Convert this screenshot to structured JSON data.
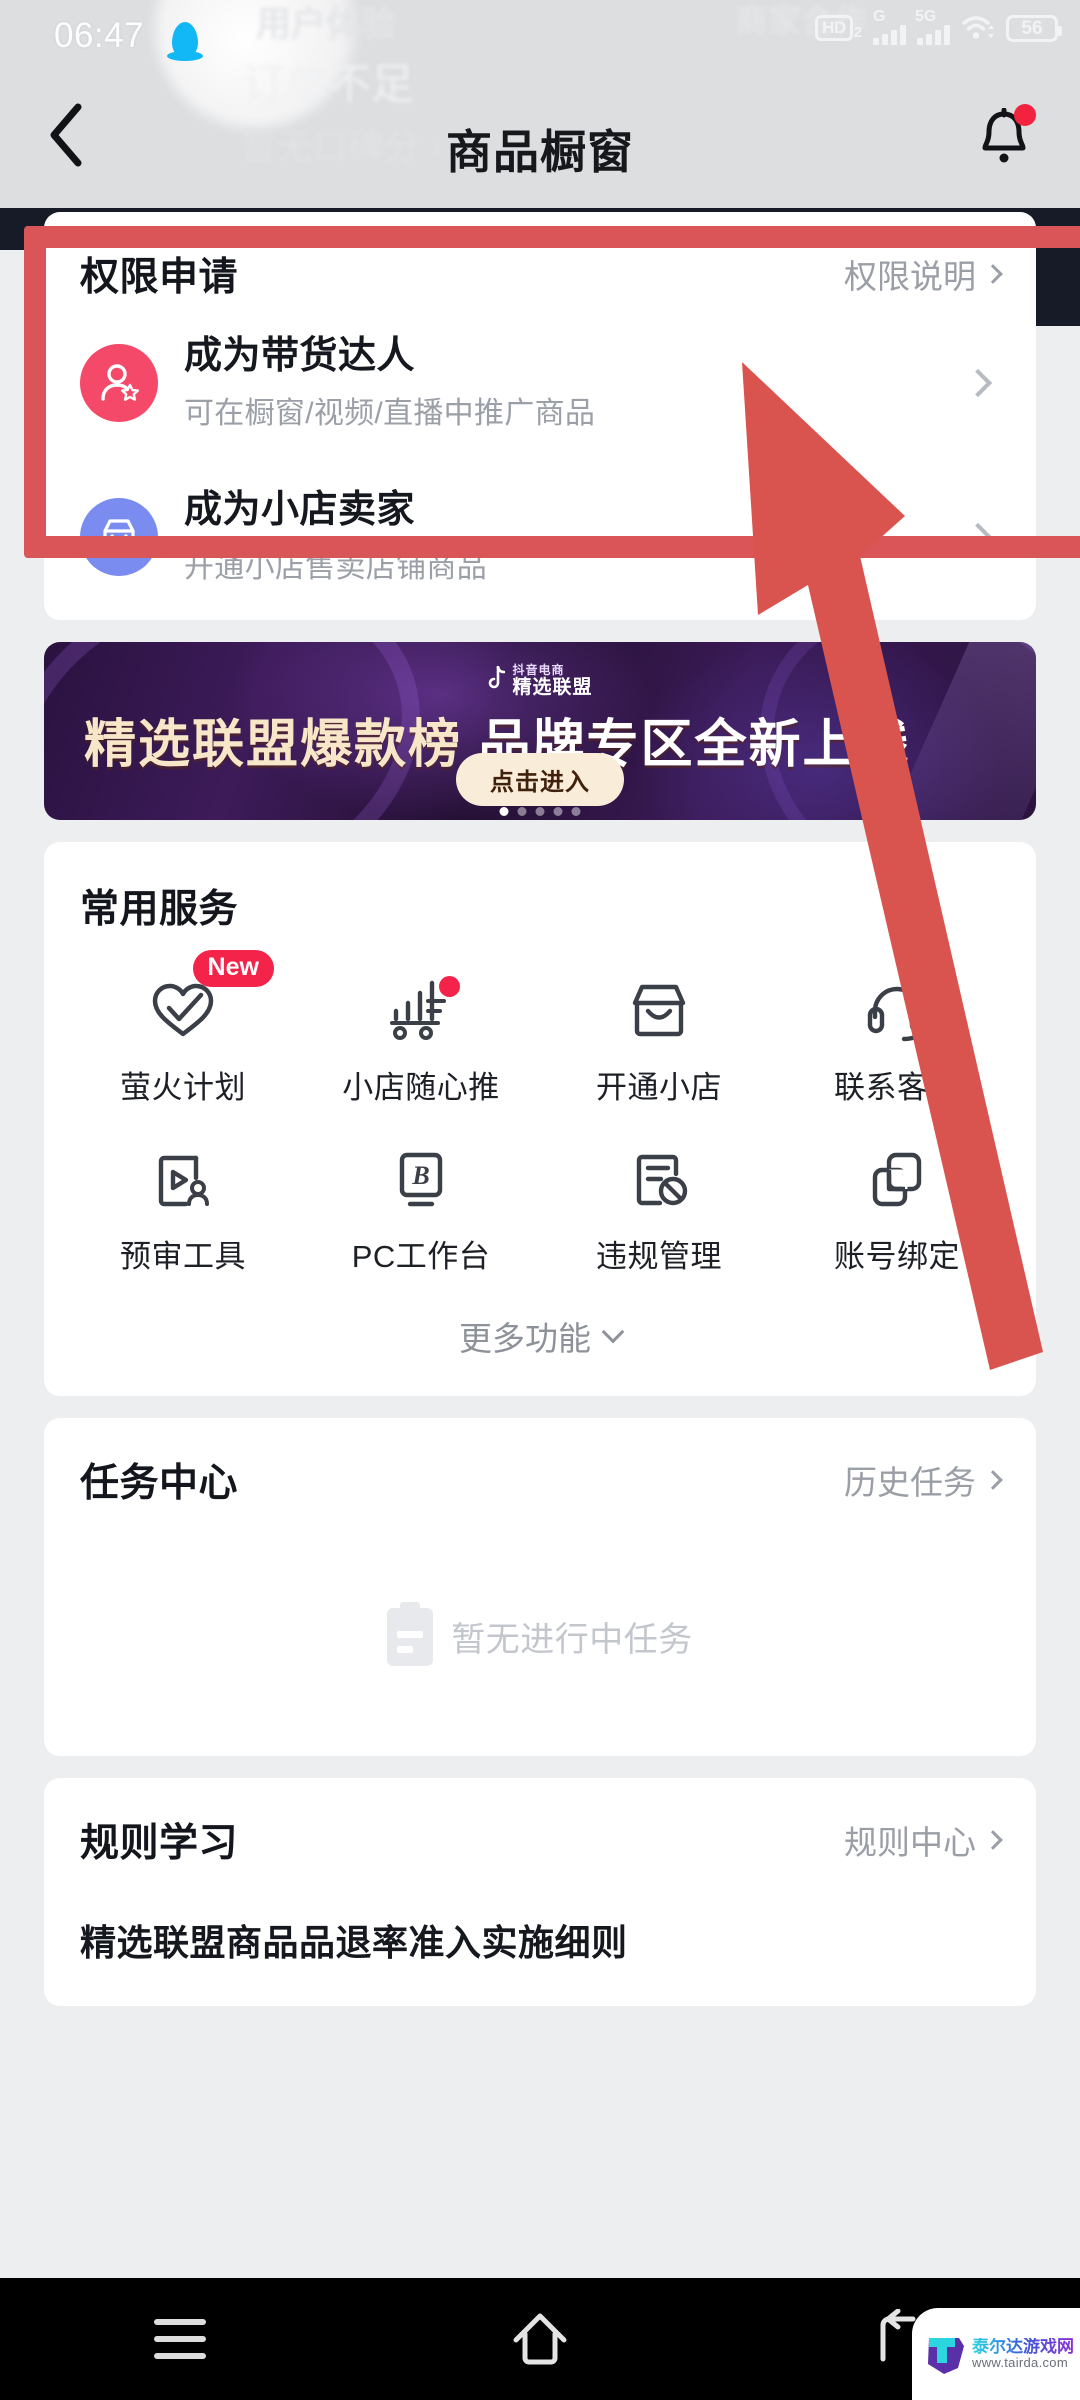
{
  "status_bar": {
    "time": "06:47",
    "qq_icon": "qq-penguin-icon",
    "hd_label": "HD",
    "hd_sub": "2",
    "net1_label": "G",
    "net2_label": "5G",
    "wifi_icon": "wifi-icon",
    "battery_level": "56"
  },
  "background": {
    "text1": "用户体验",
    "text2": "订单不足",
    "text3": "暂无口碑分 ›",
    "text4": "商家合作"
  },
  "header": {
    "back_icon": "chevron-left-icon",
    "title": "商品橱窗",
    "bell_icon": "bell-icon"
  },
  "permission_card": {
    "title": "权限申请",
    "link": "权限说明",
    "rows": [
      {
        "icon": "user-star-icon",
        "title": "成为带货达人",
        "desc": "可在橱窗/视频/直播中推广商品",
        "color": "#f5496a"
      },
      {
        "icon": "shop-icon",
        "title": "成为小店卖家",
        "desc": "开通小店售卖店铺商品",
        "color": "#7b8cf0"
      }
    ]
  },
  "banner": {
    "logo_small": "抖音电商",
    "logo_main": "精选联盟",
    "title_part1": "精选联盟爆款榜",
    "title_part2": "品牌专区全新上线",
    "button": "点击进入",
    "dots_total": 5,
    "dots_active": 1
  },
  "services": {
    "title": "常用服务",
    "items": [
      {
        "icon": "heart-check-icon",
        "label": "萤火计划",
        "badge": "New"
      },
      {
        "icon": "bar-chart-promo-icon",
        "label": "小店随心推",
        "badge": "dot"
      },
      {
        "icon": "shop-open-icon",
        "label": "开通小店",
        "badge": ""
      },
      {
        "icon": "headset-icon",
        "label": "联系客服",
        "badge": ""
      },
      {
        "icon": "video-review-icon",
        "label": "预审工具",
        "badge": ""
      },
      {
        "icon": "b-workbench-icon",
        "label": "PC工作台",
        "badge": ""
      },
      {
        "icon": "doc-ban-icon",
        "label": "违规管理",
        "badge": ""
      },
      {
        "icon": "link-account-icon",
        "label": "账号绑定",
        "badge": ""
      }
    ],
    "more_label": "更多功能"
  },
  "task_center": {
    "title": "任务中心",
    "link": "历史任务",
    "empty_icon": "clipboard-icon",
    "empty_text": "暂无进行中任务"
  },
  "rules": {
    "title": "规则学习",
    "link": "规则中心",
    "items": [
      "精选联盟商品品退率准入实施细则"
    ]
  },
  "annotation": {
    "highlight_color": "#da5558",
    "arrow_color": "#d9544f"
  },
  "nav_bar": {
    "menu_icon": "menu-icon",
    "home_icon": "home-icon",
    "back_icon": "back-arrow-icon"
  },
  "watermark": {
    "name": "泰尔达游戏网",
    "url": "www.tairda.com"
  }
}
